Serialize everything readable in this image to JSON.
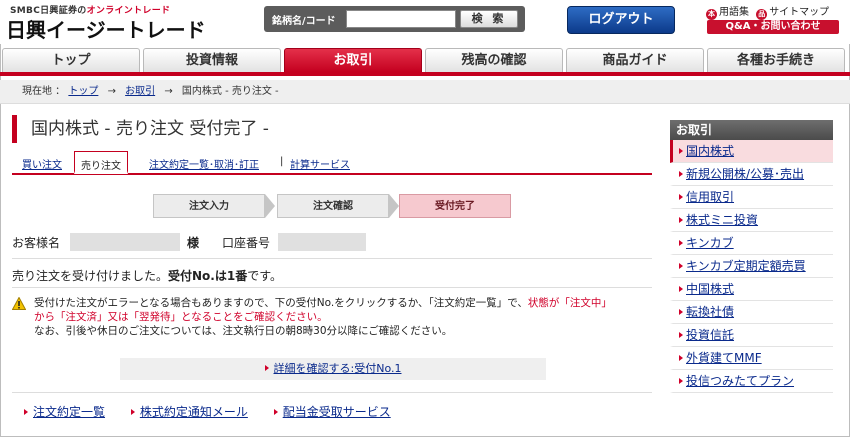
{
  "header": {
    "brand_sub_prefix": "SMBC日興証券の",
    "brand_sub_highlight": "オンライントレード",
    "brand_main": "日興イージートレード",
    "search_label": "銘柄名/コード",
    "search_value": "",
    "search_button": "検 索",
    "logout_button": "ログアウト",
    "glossary_icon": "本",
    "glossary_link": "用語集",
    "sitemap_icon": "品",
    "sitemap_link": "サイトマップ",
    "qa_button": "Q&A・お問い合わせ"
  },
  "nav": {
    "tabs": [
      {
        "label": "トップ"
      },
      {
        "label": "投資情報"
      },
      {
        "label": "お取引"
      },
      {
        "label": "残高の確認"
      },
      {
        "label": "商品ガイド"
      },
      {
        "label": "各種お手続き"
      }
    ],
    "active_index": 2
  },
  "breadcrumb": {
    "prefix": "現在地 ：",
    "items": [
      "トップ",
      "お取引",
      "国内株式 - 売り注文 -"
    ],
    "arrow": "→"
  },
  "page": {
    "title": "国内株式 - 売り注文 受付完了 -",
    "subtabs": [
      "買い注文",
      "売り注文",
      "注文約定一覧･取消･訂正",
      "計算サービス"
    ],
    "subtab_sep": "|",
    "steps": [
      "注文入力",
      "注文確認",
      "受付完了"
    ],
    "current_step": 2,
    "customer_label": "お客様名",
    "honorific": "様",
    "account_label": "口座番号",
    "accept_prefix": "売り注文を受け付けました。",
    "accept_bold": "受付No.は1番",
    "accept_suffix": "です。",
    "warn_line1_a": "受付けた注文がエラーとなる場合もありますので、下の受付No.をクリックするか、「注文約定一覧」で、",
    "warn_line1_b": "状態が「注文中」",
    "warn_line2": "から「注文済」又は「翌発待」となることをご確認ください。",
    "warn_line3": "なお、引後や休日のご注文については、注文執行日の朝8時30分以降にご確認ください。",
    "detail_link": "詳細を確認する:受付No.1",
    "footer_links": [
      "注文約定一覧",
      "株式約定通知メール",
      "配当金受取サービス"
    ]
  },
  "sidebar": {
    "heading": "お取引",
    "items": [
      "国内株式",
      "新規公開株/公募･売出",
      "信用取引",
      "株式ミニ投資",
      "キンカブ",
      "キンカブ定期定額売買",
      "中国株式",
      "転換社債",
      "投資信託",
      "外貨建てMMF",
      "投信つみたてプラン"
    ],
    "active_index": 0
  },
  "colors": {
    "brand_red": "#c4001f",
    "logout_blue": "#0c3a8a",
    "link_blue": "#0a2a8c"
  }
}
